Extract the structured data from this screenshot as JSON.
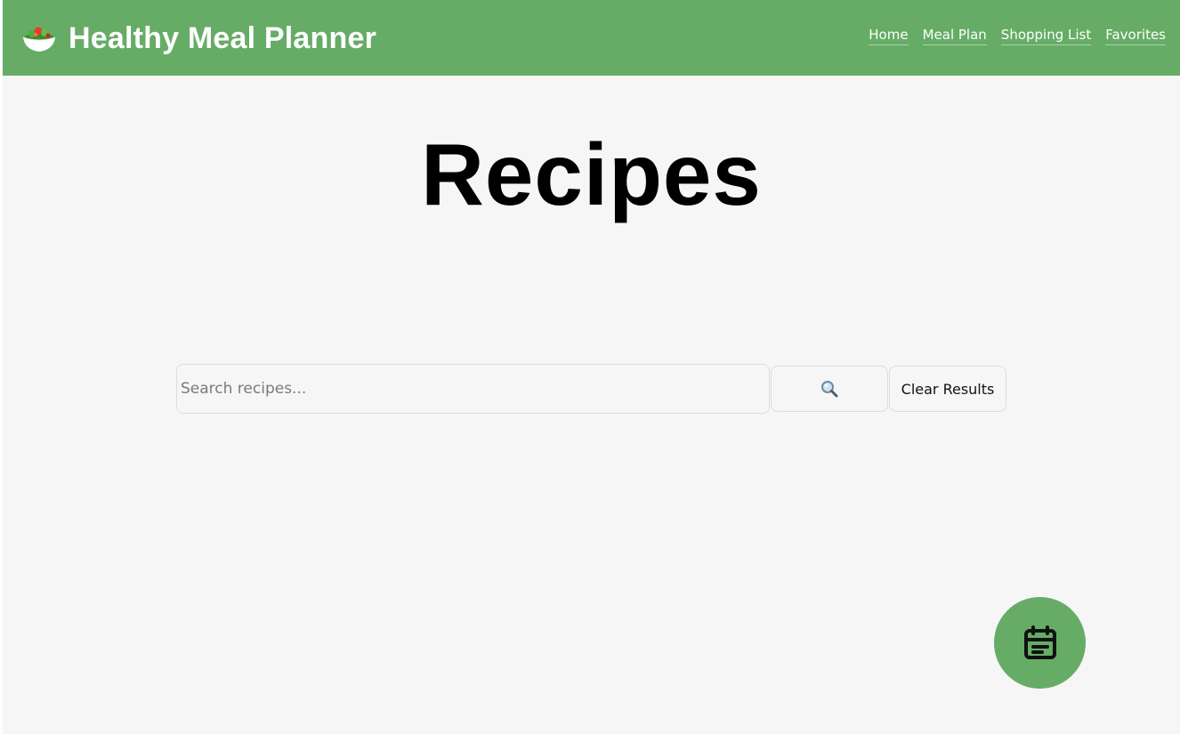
{
  "header": {
    "app_title": "Healthy Meal Planner",
    "logo_icon": "salad-bowl-icon",
    "background_color": "#66ac66",
    "nav": [
      {
        "label": "Home"
      },
      {
        "label": "Meal Plan"
      },
      {
        "label": "Shopping List"
      },
      {
        "label": "Favorites"
      }
    ]
  },
  "main": {
    "title": "Recipes",
    "search": {
      "placeholder": "Search recipes...",
      "value": "",
      "search_button_icon": "magnifying-glass-icon",
      "clear_label": "Clear Results"
    }
  },
  "fab": {
    "icon": "calendar-icon",
    "color": "#66ac66"
  }
}
